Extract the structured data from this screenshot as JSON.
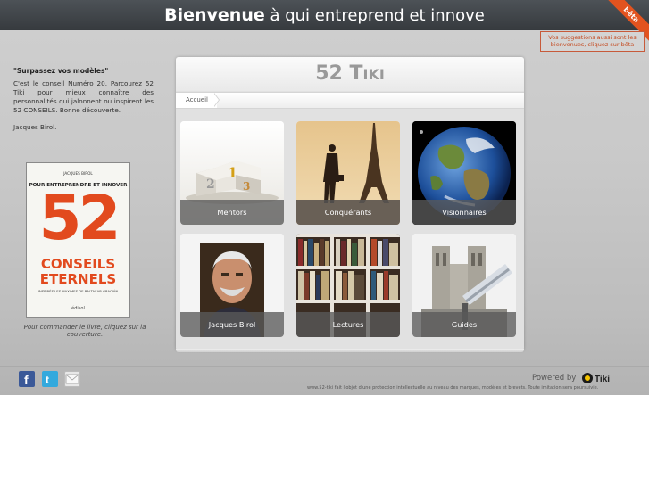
{
  "header": {
    "title_bold": "Bienvenue",
    "title_rest": "à qui entreprend et innove",
    "ribbon": "bêta"
  },
  "suggestion": {
    "text": "Vos suggestions aussi sont les bienvenues, cliquez sur bêta"
  },
  "intro": {
    "title": "\"Surpassez vos modèles\"",
    "body": "C'est le conseil Numéro 20. Parcourez 52 Tiki pour mieux connaître des personnalités qui jalonnent ou inspirent les 52 CONSEILS. Bonne découverte.",
    "author": "Jacques Birol."
  },
  "book": {
    "author": "JACQUES BIROL",
    "tagline": "POUR ENTREPRENDRE ET INNOVER",
    "number": "52",
    "title_line1": "CONSEILS",
    "title_line2": "ETERNELS",
    "subtitle": "INSPIRÉS LES MAXIMES DE BALTASAR GRACIÁN",
    "publisher": "édisol",
    "caption": "Pour commander le livre, cliquez sur la couverture."
  },
  "panel": {
    "title_big": "52 T",
    "title_small": "IKI",
    "breadcrumb": "Accueil"
  },
  "tiles": [
    {
      "label": "Mentors",
      "icon": "podium-image"
    },
    {
      "label": "Conquérants",
      "icon": "eiffel-tower-image"
    },
    {
      "label": "Visionnaires",
      "icon": "earth-image"
    },
    {
      "label": "Jacques Birol",
      "icon": "portrait-image"
    },
    {
      "label": "Lectures",
      "icon": "bookshelf-image"
    },
    {
      "label": "Guides",
      "icon": "telescope-notre-dame-image"
    }
  ],
  "footer": {
    "powered_by": "Powered by",
    "tiki_brand": "Tiki",
    "legal": "www.52-tiki fait l'objet d'une protection intellectuelle au niveau des marques, modèles et brevets. Toute imitation sera poursuivie."
  },
  "colors": {
    "accent": "#e24a1e",
    "topbar": "#3f4347",
    "facebook": "#3b5998",
    "twitter": "#33a9dd"
  }
}
